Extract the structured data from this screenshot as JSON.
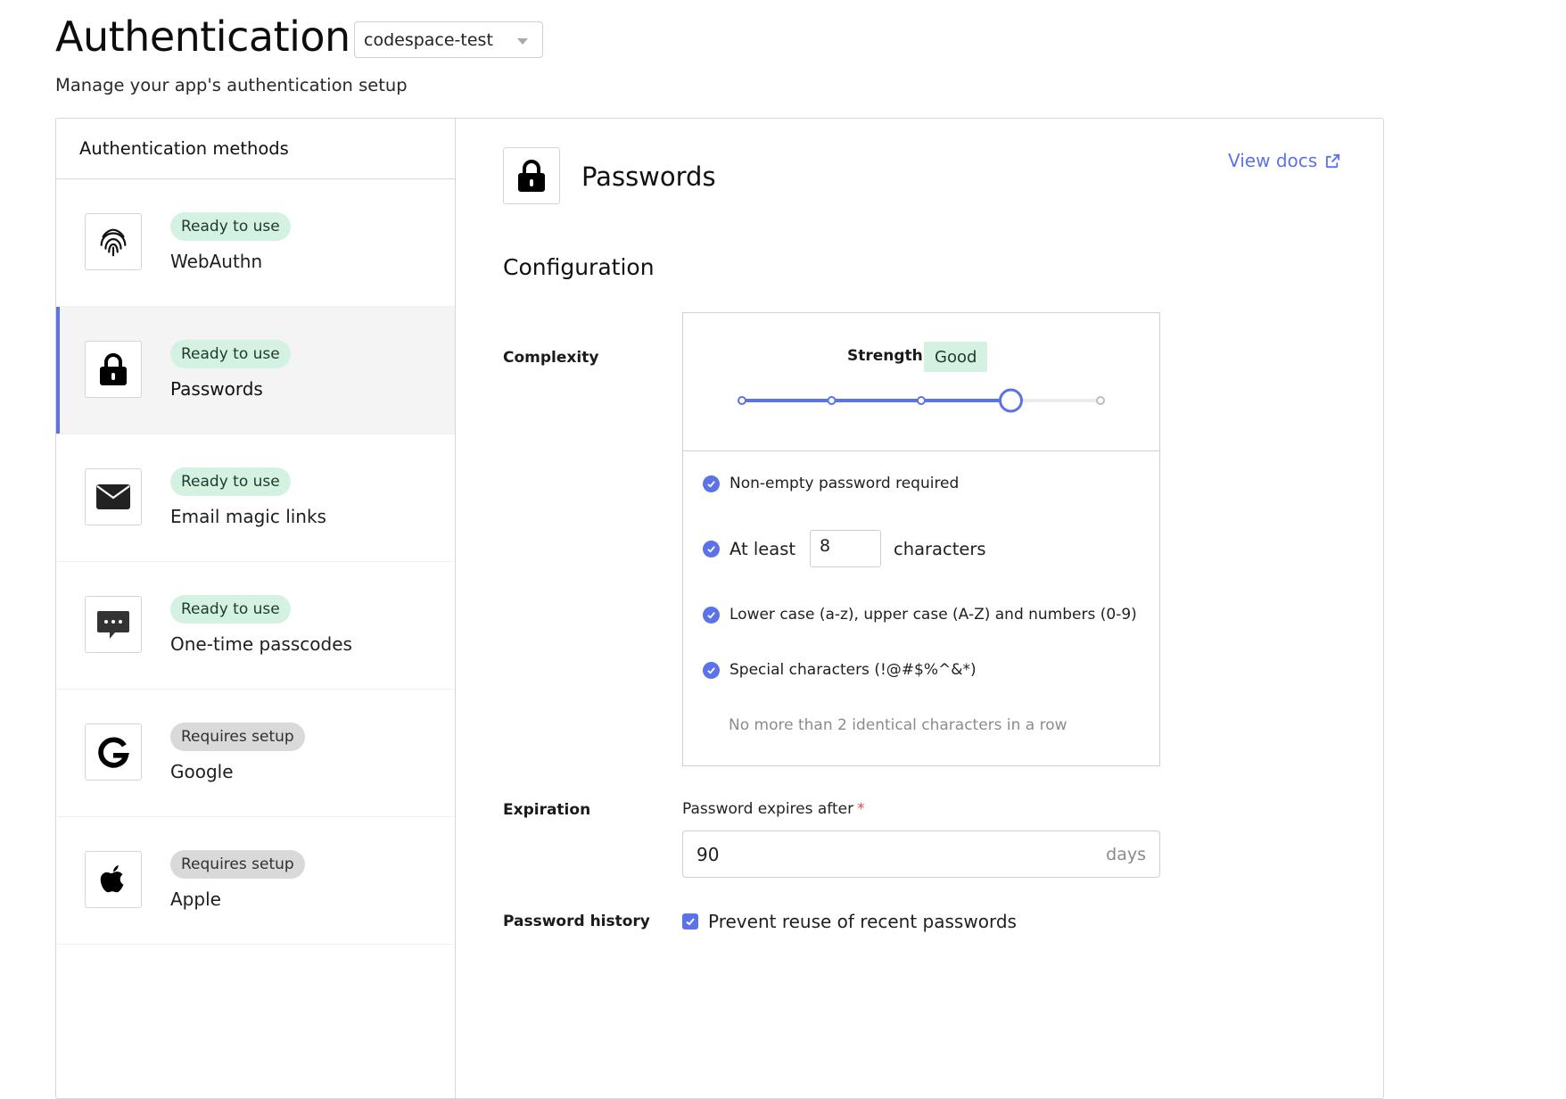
{
  "header": {
    "title": "Authentication",
    "project_select": "codespace-test",
    "subtitle": "Manage your app's authentication setup"
  },
  "sidebar": {
    "title": "Authentication methods",
    "items": [
      {
        "label": "WebAuthn",
        "status": "Ready to use",
        "icon": "fingerprint-icon"
      },
      {
        "label": "Passwords",
        "status": "Ready to use",
        "icon": "lock-icon"
      },
      {
        "label": "Email magic links",
        "status": "Ready to use",
        "icon": "envelope-icon"
      },
      {
        "label": "One-time passcodes",
        "status": "Ready to use",
        "icon": "chat-bubble-icon"
      },
      {
        "label": "Google",
        "status": "Requires setup",
        "icon": "google-icon"
      },
      {
        "label": "Apple",
        "status": "Requires setup",
        "icon": "apple-icon"
      }
    ]
  },
  "main": {
    "title": "Passwords",
    "docs_link": "View docs",
    "section_title": "Configuration",
    "complexity": {
      "label": "Complexity",
      "strength_label": "Strength:",
      "strength_value": "Good",
      "slider_level": 4,
      "slider_steps": 5,
      "rules": {
        "non_empty": "Non-empty password required",
        "at_least": "At least",
        "min_chars": "8",
        "characters": "characters",
        "case_numbers": "Lower case (a-z), upper case (A-Z) and numbers (0-9)",
        "special": "Special characters (!@#$%^&*)",
        "identical": "No more than 2 identical characters in a row"
      }
    },
    "expiration": {
      "label": "Expiration",
      "field_label": "Password expires after",
      "required_mark": "*",
      "value": "90",
      "unit": "days"
    },
    "history": {
      "label": "Password history",
      "checkbox_label": "Prevent reuse of recent passwords",
      "checked": true
    }
  },
  "colors": {
    "accent": "#5b72e8",
    "ready_bg": "#d3f2e2",
    "setup_bg": "#d9d9d9"
  }
}
